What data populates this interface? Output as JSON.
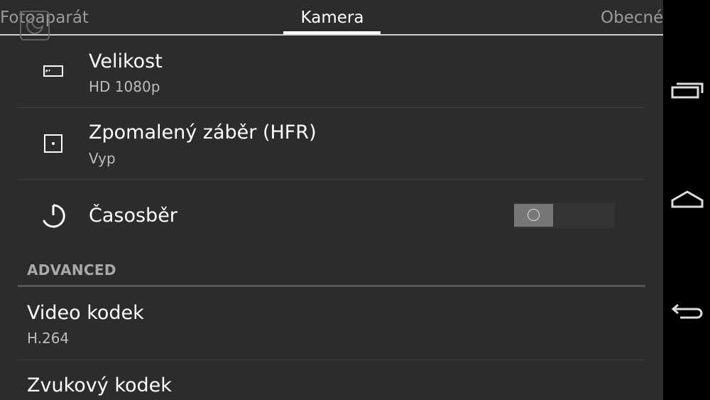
{
  "tabs": [
    {
      "label": "Fotoaparát",
      "active": false
    },
    {
      "label": "Kamera",
      "active": true
    },
    {
      "label": "Obecné",
      "active": false
    }
  ],
  "settings": {
    "size": {
      "title": "Velikost",
      "value": "HD 1080p",
      "icon": "screen-size-icon"
    },
    "hfr": {
      "title": "Zpomalený záběr (HFR)",
      "value": "Vyp",
      "icon": "focus-square-icon"
    },
    "timelapse": {
      "title": "Časosběr",
      "icon": "timer-icon",
      "toggle_on": false
    }
  },
  "advanced": {
    "header": "ADVANCED",
    "video_codec": {
      "title": "Video kodek",
      "value": "H.264"
    },
    "audio_codec": {
      "title": "Zvukový kodek"
    }
  },
  "navbar": {
    "buttons": [
      "recent-apps-icon",
      "home-icon",
      "back-icon"
    ]
  },
  "colors": {
    "background": "#2c2c2c",
    "navbar": "#000000",
    "active_tab": "#ffffff",
    "inactive_tab": "#9a9a9a"
  }
}
